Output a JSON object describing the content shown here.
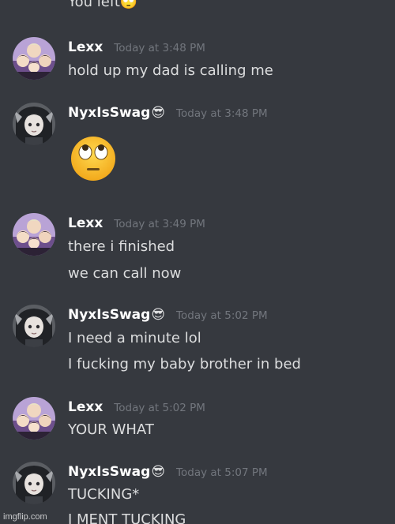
{
  "chat": {
    "fragment_text": "You left🙄",
    "messages": [
      {
        "username": "Lexx",
        "username_emoji": "",
        "timestamp": "Today at 3:48 PM",
        "avatar_icon": "group-anime-avatar",
        "lines": [
          "hold up my dad is calling me"
        ]
      },
      {
        "username": "NyxIsSwag",
        "username_emoji": "😎",
        "timestamp": "Today at 3:48 PM",
        "avatar_icon": "anime-girl-avatar",
        "big_emoji": "eye-roll-emoji",
        "lines": []
      },
      {
        "username": "Lexx",
        "username_emoji": "",
        "timestamp": "Today at 3:49 PM",
        "avatar_icon": "group-anime-avatar",
        "lines": [
          "there i finished",
          "we can call now"
        ]
      },
      {
        "username": "NyxIsSwag",
        "username_emoji": "😎",
        "timestamp": "Today at 5:02 PM",
        "avatar_icon": "anime-girl-avatar",
        "lines": [
          "I need a minute lol",
          "I fucking my baby brother in bed"
        ]
      },
      {
        "username": "Lexx",
        "username_emoji": "",
        "timestamp": "Today at 5:02 PM",
        "avatar_icon": "group-anime-avatar",
        "lines": [
          "YOUR WHAT"
        ]
      },
      {
        "username": "NyxIsSwag",
        "username_emoji": "😎",
        "timestamp": "Today at 5:07 PM",
        "avatar_icon": "anime-girl-avatar",
        "lines": [
          "TUCKING*",
          "I MENT TUCKING"
        ]
      }
    ]
  },
  "watermark": "imgflip.com",
  "colors": {
    "background": "#36393f",
    "username": "#ffffff",
    "message_text": "#dcddde",
    "timestamp": "#72767d"
  }
}
